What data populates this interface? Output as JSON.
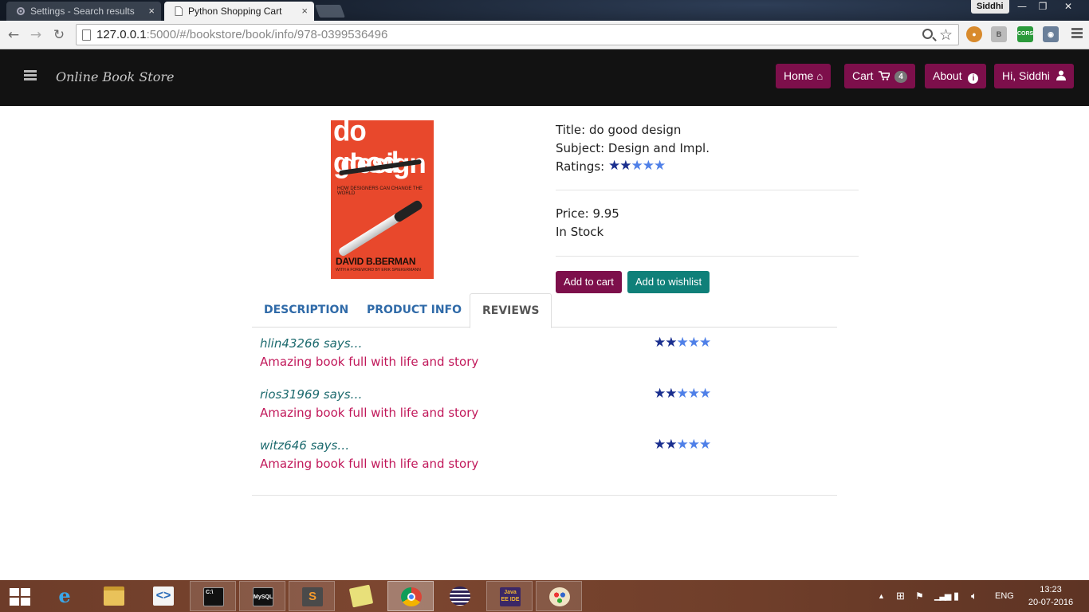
{
  "browser": {
    "tabs": [
      {
        "label": "Settings - Search results",
        "close": "×"
      },
      {
        "label": "Python Shopping Cart",
        "close": "×"
      }
    ],
    "profile": "Siddhi",
    "window_controls": {
      "minimize": "—",
      "restore": "❐",
      "close": "✕"
    },
    "url_host": "127.0.0.1",
    "url_rest": ":5000/#/bookstore/book/info/978-0399536496",
    "extensions": [
      "B",
      "CORS"
    ]
  },
  "navbar": {
    "brand": "Online Book Store",
    "home": "Home",
    "cart": "Cart",
    "cart_count": "4",
    "about": "About",
    "user": "Hi, Siddhi"
  },
  "book": {
    "cover_line1": "do good",
    "cover_line2": "design",
    "cover_subtitle": "HOW DESIGNERS CAN CHANGE THE WORLD",
    "cover_author": "DAVID B.BERMAN",
    "cover_foreword": "WITH A FOREWORD BY ERIK SPIEKERMANN",
    "title_label": "Title:",
    "title": "do good design",
    "subject_label": "Subject:",
    "subject": "Design and Impl.",
    "ratings_label": "Ratings:",
    "rating": 2,
    "rating_max": 5,
    "price_label": "Price:",
    "price": "9.95",
    "stock": "In Stock"
  },
  "actions": {
    "add_to_cart": "Add to cart",
    "add_to_wishlist": "Add to wishlist"
  },
  "tabs": [
    {
      "label": "DESCRIPTION",
      "active": false
    },
    {
      "label": "PRODUCT INFO",
      "active": false
    },
    {
      "label": "REVIEWS",
      "active": true
    }
  ],
  "reviews": [
    {
      "user": "hlin43266 says…",
      "text": "Amazing book full with life and story",
      "rating": 2
    },
    {
      "user": "rios31969 says…",
      "text": "Amazing book full with life and story",
      "rating": 2
    },
    {
      "user": "witz646 says…",
      "text": "Amazing book full with life and story",
      "rating": 2
    }
  ],
  "colors": {
    "navbar_bg": "#121212",
    "primary_button": "#7d0f4b",
    "secondary_button": "#0f8079",
    "star_filled": "#1a2f8f",
    "star_empty": "#4f80e8",
    "review_text": "#c1185a",
    "review_user": "#1c6a6e",
    "tab_link": "#2f6aa8"
  },
  "taskbar": {
    "apps": [
      "internet-explorer",
      "file-explorer",
      "visual-studio-code",
      "command-prompt",
      "mysql",
      "sublime-text",
      "sticky-notes",
      "chrome",
      "eclipse",
      "java-ee-ide",
      "paint"
    ],
    "java_ee_label": "Java EE IDE",
    "mysql_label": "MySQL",
    "cmd_label": "C:\\",
    "language": "ENG",
    "time": "13:23",
    "date": "20-07-2016"
  }
}
